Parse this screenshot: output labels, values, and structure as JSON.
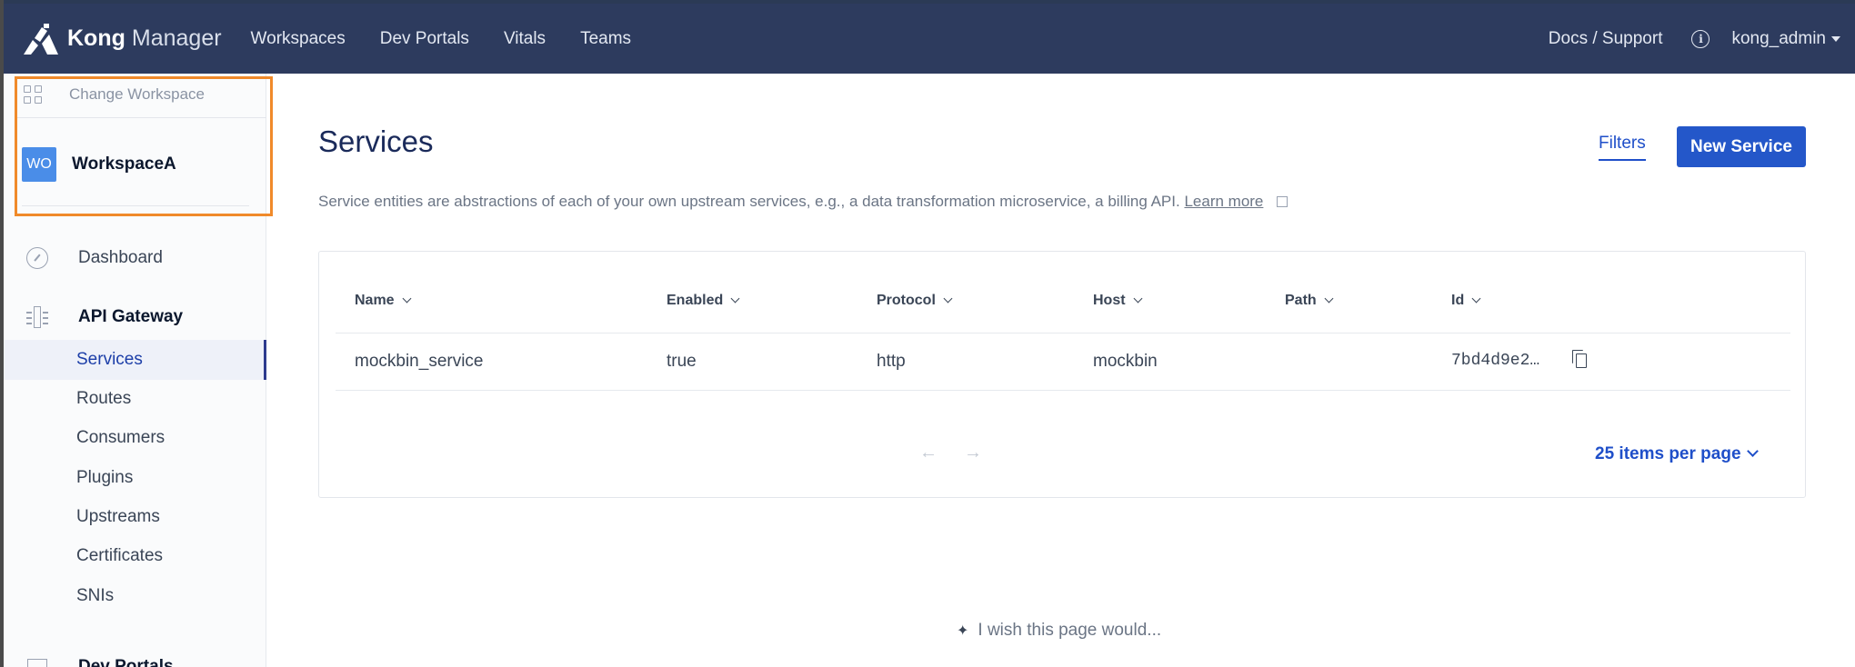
{
  "topnav": {
    "brand_kong": "Kong",
    "brand_manager": "Manager",
    "links": [
      "Workspaces",
      "Dev Portals",
      "Vitals",
      "Teams"
    ],
    "docs": "Docs / Support",
    "user": "kong_admin"
  },
  "sidebar": {
    "change_workspace": "Change Workspace",
    "workspace_avatar": "WO",
    "workspace_name": "WorkspaceA",
    "dashboard": "Dashboard",
    "api_gateway": "API Gateway",
    "items": [
      "Services",
      "Routes",
      "Consumers",
      "Plugins",
      "Upstreams",
      "Certificates",
      "SNIs"
    ],
    "active_item": "Services",
    "next_section_partial": "Dev Portals"
  },
  "main": {
    "title": "Services",
    "filters": "Filters",
    "new_service": "New Service",
    "description": "Service entities are abstractions of each of your own upstream services, e.g., a data transformation microservice, a billing API.",
    "learn_more": "Learn more",
    "table": {
      "headers": [
        "Name",
        "Enabled",
        "Protocol",
        "Host",
        "Path",
        "Id"
      ],
      "rows": [
        {
          "name": "mockbin_service",
          "enabled": "true",
          "protocol": "http",
          "host": "mockbin",
          "path": "",
          "id": "7bd4d9e2…"
        }
      ]
    },
    "pagination": {
      "prev": "←",
      "next": "→",
      "per_page": "25 items per page"
    },
    "wish": "I wish this page would..."
  },
  "colors": {
    "nav_bg": "#2d3b5e",
    "primary": "#2457c9",
    "highlight_box": "#f08a2a",
    "workspace_avatar": "#4a8de8"
  }
}
